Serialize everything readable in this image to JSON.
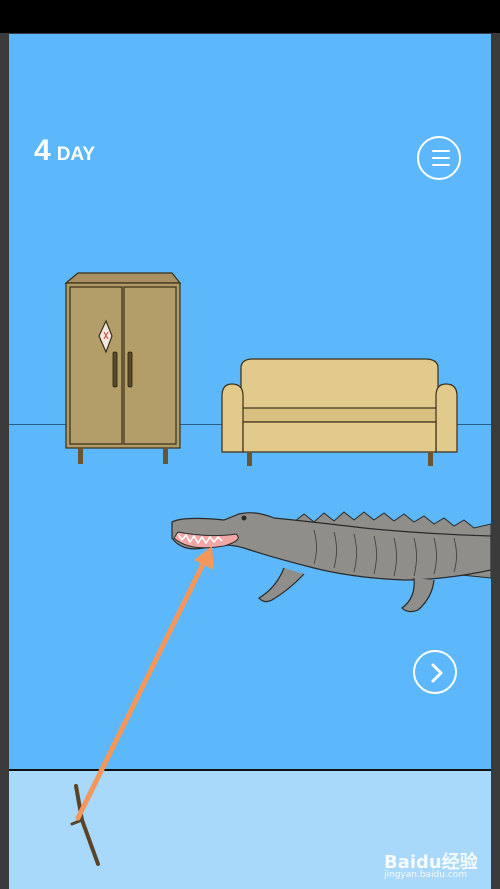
{
  "hud": {
    "day_number": "4",
    "day_label": "DAY"
  },
  "icons": {
    "menu": "hamburger-menu-icon",
    "next": "chevron-right-icon"
  },
  "scene": {
    "objects": [
      "wardrobe",
      "sofa",
      "crocodile"
    ],
    "colors": {
      "background": "#5cb8fb",
      "inventory": "#a8d8fa",
      "furniture": "#b09a66",
      "sofa": "#e2ca8c",
      "crocodile": "#8f8e8b",
      "annotation_arrow": "#f4975a"
    }
  },
  "inventory": {
    "items": [
      "stick"
    ]
  },
  "watermark": {
    "logo": "Baidu经验",
    "url": "jingyan.baidu.com"
  }
}
